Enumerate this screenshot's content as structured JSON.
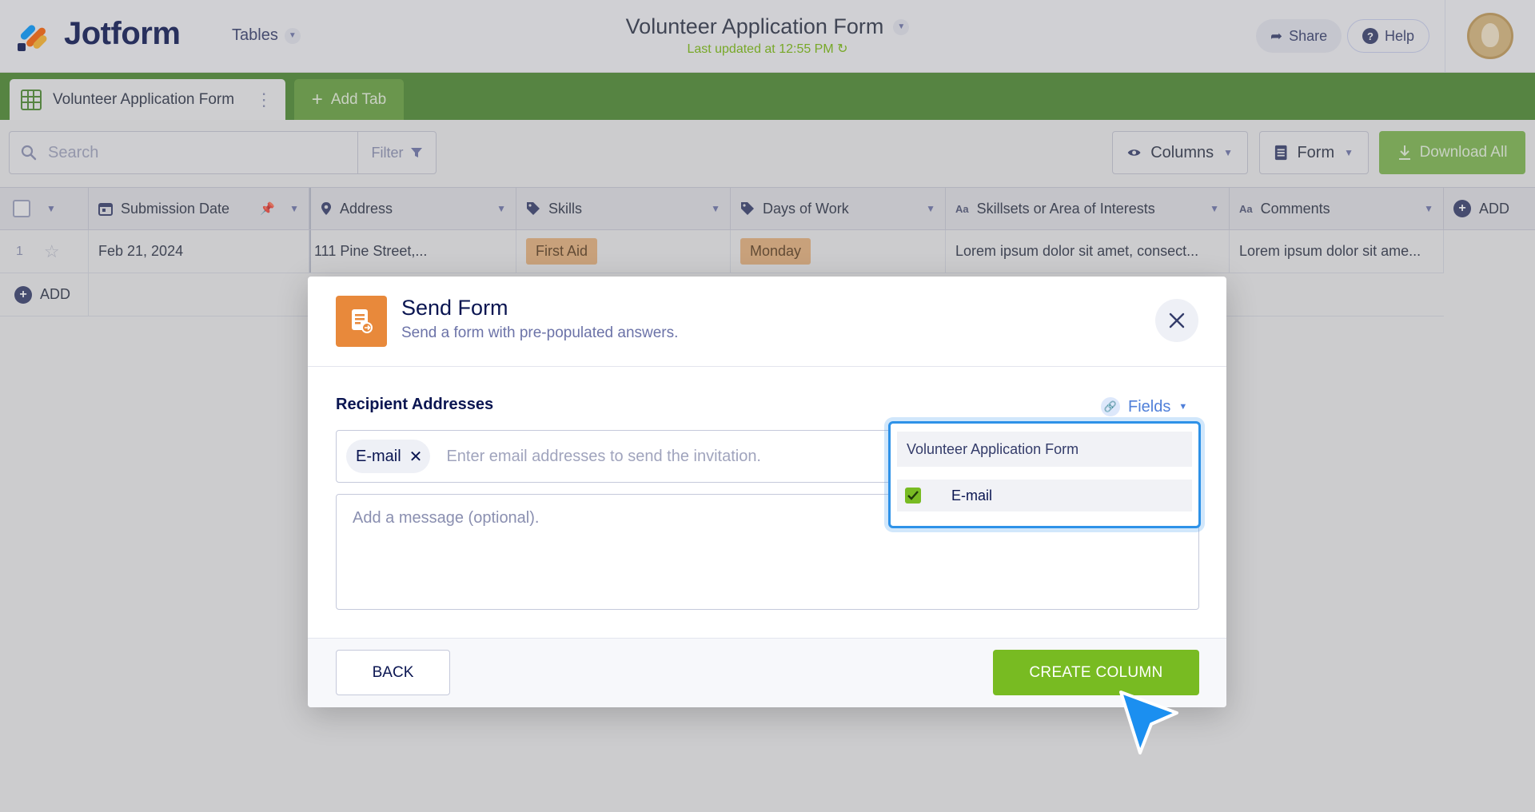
{
  "header": {
    "brand": "Jotform",
    "tables_label": "Tables",
    "form_title": "Volunteer Application Form",
    "last_updated": "Last updated at 12:55 PM",
    "share_label": "Share",
    "help_label": "Help"
  },
  "tabs": {
    "active_label": "Volunteer Application Form",
    "add_label": "Add Tab"
  },
  "toolbar": {
    "search_placeholder": "Search",
    "filter_label": "Filter",
    "columns_label": "Columns",
    "form_label": "Form",
    "download_label": "Download All"
  },
  "table": {
    "columns": [
      "Submission Date",
      "Address",
      "Skills",
      "Days of Work",
      "Skillsets or Area of Interests",
      "Comments"
    ],
    "add_column_label": "ADD",
    "rows": [
      {
        "index": "1",
        "submission_date": "Feb 21, 2024",
        "address": "111 Pine Street,...",
        "skills": "First Aid",
        "days": "Monday",
        "skillsets": "Lorem ipsum dolor sit amet, consect...",
        "comments": "Lorem ipsum dolor sit ame..."
      }
    ],
    "add_row_label": "ADD"
  },
  "modal": {
    "title": "Send Form",
    "subtitle": "Send a form with pre-populated answers.",
    "recipient_label": "Recipient Addresses",
    "fields_link": "Fields",
    "email_tag": "E-mail",
    "email_placeholder": "Enter email addresses to send the invitation.",
    "message_placeholder": "Add a message (optional).",
    "back_label": "BACK",
    "create_label": "CREATE COLUMN"
  },
  "dropdown": {
    "group_label": "Volunteer Application Form",
    "item_label": "E-mail",
    "item_checked": true
  },
  "colors": {
    "brand_green": "#4a8a2c",
    "accent_green": "#78bb22",
    "form_icon_orange": "#e8893b",
    "link_blue": "#4f7fd9",
    "focus_blue": "#2e92e8"
  },
  "icons": [
    "search-icon",
    "filter-icon",
    "eye-icon",
    "form-doc-icon",
    "download-icon",
    "calendar-icon",
    "pin-icon",
    "map-pin-icon",
    "tag-icon",
    "close-icon",
    "link-icon",
    "check-icon",
    "cursor-arrow-icon"
  ]
}
